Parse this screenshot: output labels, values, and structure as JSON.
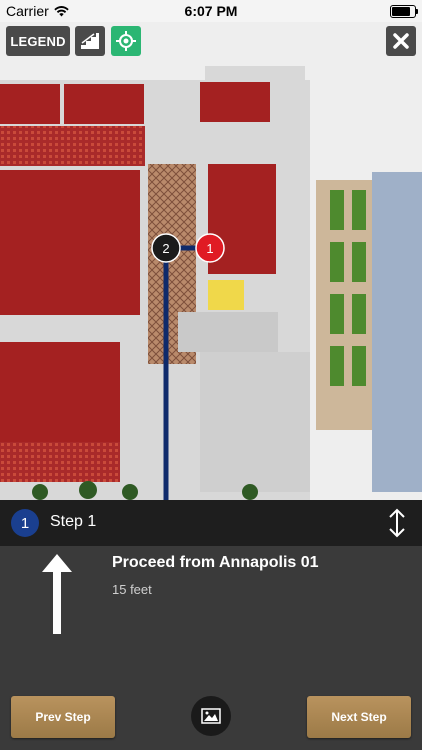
{
  "status_bar": {
    "carrier": "Carrier",
    "time": "6:07 PM",
    "battery_level": 0.9
  },
  "toolbar": {
    "legend_label": "LEGEND"
  },
  "map": {
    "route_markers": [
      {
        "label": "2",
        "color": "#1b1b1b"
      },
      {
        "label": "1",
        "color": "#e01b24"
      }
    ],
    "route_color": "#0f2a6b"
  },
  "step": {
    "number": "1",
    "title": "Step 1"
  },
  "instruction": {
    "text": "Proceed from Annapolis 01",
    "distance": "15 feet"
  },
  "buttons": {
    "prev_label": "Prev Step",
    "next_label": "Next Step"
  },
  "colors": {
    "accent_green": "#2bb673",
    "button_gold": "#b9935e",
    "step_blue": "#1a3f8f"
  }
}
